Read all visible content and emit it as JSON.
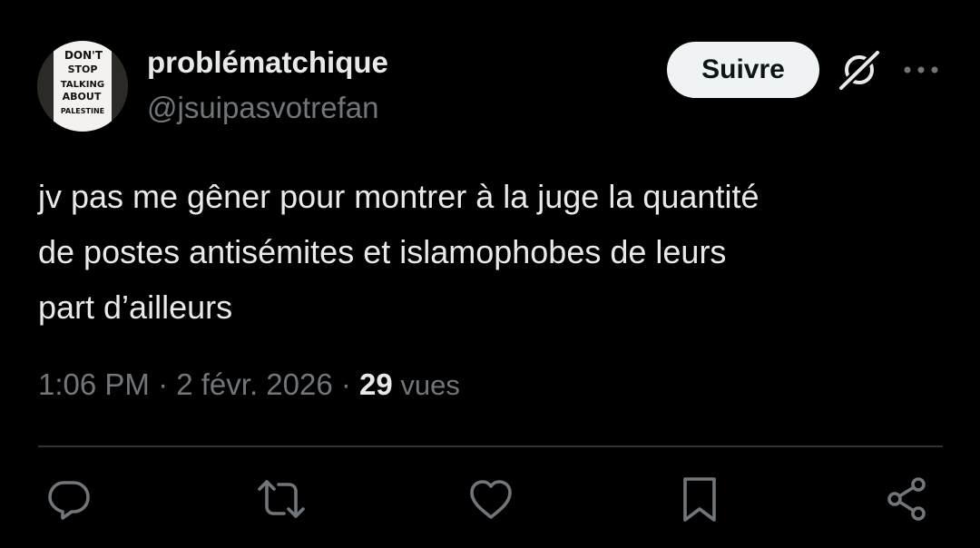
{
  "author": {
    "display_name": "problématchique",
    "handle": "@jsuipasvotrefan",
    "avatar_sign_text": [
      "DON'T",
      "STOP",
      "TALKING",
      "ABOUT",
      "PALESTINE"
    ]
  },
  "follow_label": "Suivre",
  "tweet": {
    "lines": [
      "jv pas me gêner pour montrer à la juge la quantité",
      "de postes antisémites et islamophobes de leurs",
      "part d’ailleurs"
    ],
    "time": "1:06 PM",
    "sep1": " · ",
    "date": "2 févr. 2026",
    "sep2": " · ",
    "views_count": "29",
    "views_label": " vues"
  },
  "icons": {
    "header": [
      "grok-icon",
      "more-icon"
    ],
    "actions": [
      "reply-icon",
      "repost-icon",
      "like-icon",
      "bookmark-icon",
      "share-icon"
    ]
  },
  "colors": {
    "background": "#000000",
    "primary_text": "#e7e9ea",
    "secondary_text": "#71767b",
    "follow_button_bg": "#eff3f4",
    "divider": "#2f3336"
  }
}
